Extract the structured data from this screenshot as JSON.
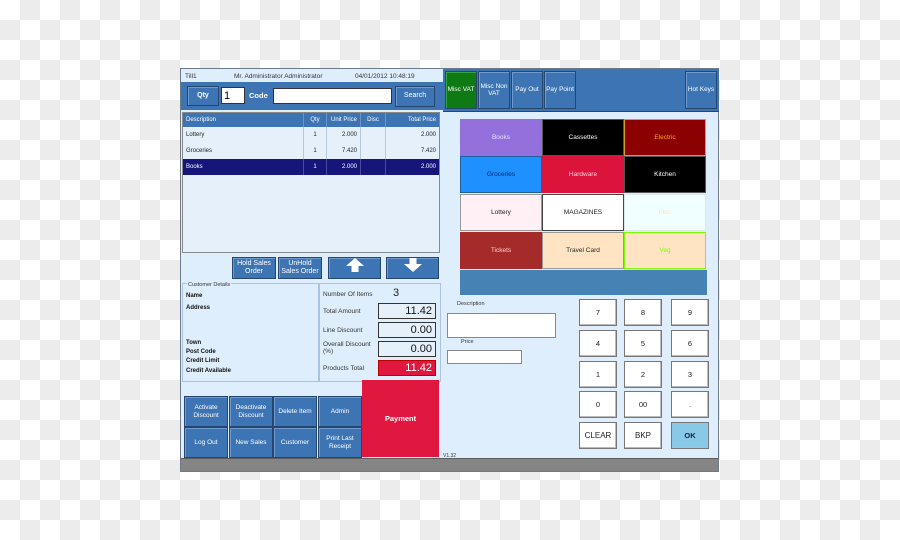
{
  "header": {
    "till": "Till1",
    "user": "Mr. Administrator Administrator",
    "datetime": "04/01/2012 10:48:19"
  },
  "entry": {
    "qty_label": "Qty",
    "qty_value": "1",
    "code_label": "Code",
    "code_value": "",
    "search_label": "Search"
  },
  "table": {
    "columns": [
      "Description",
      "Qty",
      "Unit Price",
      "Disc",
      "Total Price"
    ],
    "rows": [
      {
        "description": "Lottery",
        "qty": "1",
        "unit_price": "2.000",
        "disc": "",
        "total_price": "2.000"
      },
      {
        "description": "Groceries",
        "qty": "1",
        "unit_price": "7.420",
        "disc": "",
        "total_price": "7.420"
      },
      {
        "description": "Books",
        "qty": "1",
        "unit_price": "2.000",
        "disc": "",
        "total_price": "2.000",
        "selected": true
      }
    ]
  },
  "order_actions": {
    "hold": "Hold Sales Order",
    "unhold": "UnHold Sales Order",
    "up_icon": "arrow-up-icon",
    "down_icon": "arrow-down-icon",
    "up_glyph": "🡅",
    "down_glyph": "🡇"
  },
  "customer": {
    "legend": "Customer Details",
    "labels": [
      "Name",
      "Address",
      "Town",
      "Post Code",
      "Credit Limit",
      "Credit Available"
    ]
  },
  "totals": {
    "items_label": "Number Of Items",
    "items_value": "3",
    "total_amount_label": "Total Amount",
    "total_amount": "11.42",
    "line_discount_label": "Line Discount",
    "line_discount": "0.00",
    "overall_discount_label": "Overall Discount (%)",
    "overall_discount": "0.00",
    "products_total_label": "Products Total",
    "products_total": "11.42"
  },
  "functions": {
    "activate_discount": "Activate Discount",
    "deactivate_discount": "Deactivate Discount",
    "delete_item": "Delete Item",
    "admin": "Admin",
    "log_out": "Log Out",
    "new_sales": "New Sales",
    "customer": "Customer",
    "print_last_receipt": "Print Last Receipt",
    "payment": "Payment"
  },
  "version": "V1.32",
  "right_tabs": {
    "misc_vat": "Misc VAT",
    "misc_non_vat": "Misc Non VAT",
    "pay_out": "Pay Out",
    "pay_point": "Pay Point",
    "hot_keys": "Hot Keys",
    "active": "misc_vat"
  },
  "categories": [
    {
      "label": "Books",
      "bg": "#9370db",
      "fg": "#e8e0ff",
      "border": "#9370db"
    },
    {
      "label": "Cassettes",
      "bg": "#000000",
      "fg": "#ffffff",
      "border": "#555555"
    },
    {
      "label": "Electric",
      "bg": "#8b0000",
      "fg": "#ffa500",
      "border": "#d4a017"
    },
    {
      "label": "Groceries",
      "bg": "#1e90ff",
      "fg": "#0a2a6b",
      "border": "#1e5fa0"
    },
    {
      "label": "Hardware",
      "bg": "#dc143c",
      "fg": "#ffd0d8",
      "border": "#dc143c"
    },
    {
      "label": "Kitchen",
      "bg": "#000000",
      "fg": "#ffffff",
      "border": "#555555"
    },
    {
      "label": "Lottery",
      "bg": "#fff0f5",
      "fg": "#222222",
      "border": "#999999"
    },
    {
      "label": "MAGAZINES",
      "bg": "#ffffff",
      "fg": "#222222",
      "border": "#444444"
    },
    {
      "label": "Pets",
      "bg": "#f0ffff",
      "fg": "#ffe4c4",
      "border": "#dde8ee"
    },
    {
      "label": "Tickets",
      "bg": "#a52a2a",
      "fg": "#ffd0d0",
      "border": "#a52a2a"
    },
    {
      "label": "Travel Card",
      "bg": "#ffe4c4",
      "fg": "#222222",
      "border": "#999999"
    },
    {
      "label": "Veg",
      "bg": "#ffe4c4",
      "fg": "#7cfc00",
      "border": "#7cfc00"
    }
  ],
  "item_entry": {
    "description_label": "Description",
    "description_value": "",
    "price_label": "Price",
    "price_value": ""
  },
  "keypad": [
    "7",
    "8",
    "9",
    "4",
    "5",
    "6",
    "1",
    "2",
    "3",
    "0",
    "00",
    ".",
    "CLEAR",
    "BKP",
    "OK"
  ]
}
